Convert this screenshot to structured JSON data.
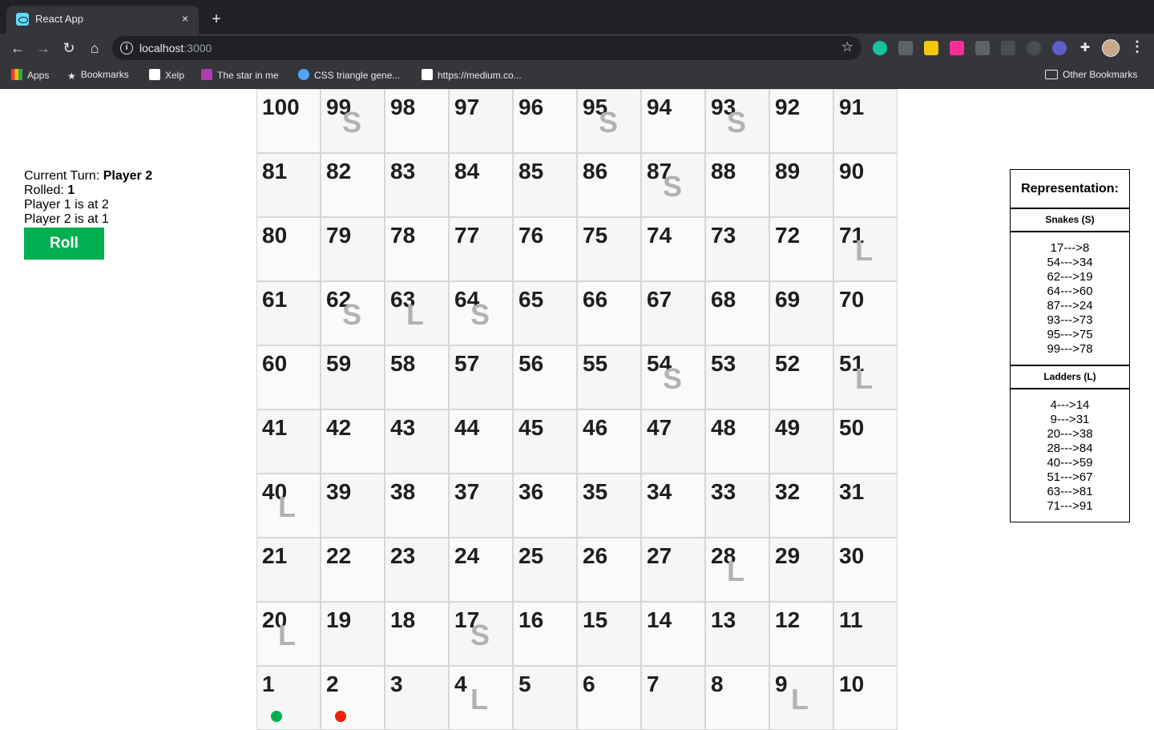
{
  "browser": {
    "tab_title": "React App",
    "tab_close": "×",
    "new_tab": "+",
    "url_host": "localhost",
    "url_port": ":3000",
    "bookmarks": [
      {
        "label": "Apps",
        "icon": "apps-grid-icon",
        "color": "#e94235"
      },
      {
        "label": "Bookmarks",
        "icon": "star-icon",
        "color": "#e8eaed"
      },
      {
        "label": "Xelp",
        "icon": "xelp-logo-icon",
        "color": "#ffffff"
      },
      {
        "label": "The star in me",
        "icon": "star-in-me-icon",
        "color": "#b23ab0"
      },
      {
        "label": "CSS triangle gene...",
        "icon": "css-triangle-icon",
        "color": "#4fa3ff"
      },
      {
        "label": "https://medium.co...",
        "icon": "medium-logo-icon",
        "color": "#ffffff"
      }
    ],
    "other_bookmarks": "Other Bookmarks"
  },
  "game": {
    "turn_label": "Current Turn: ",
    "turn_value": "Player 2",
    "rolled_label": "Rolled: ",
    "rolled_value": "1",
    "player1_status": "Player 1 is at 2",
    "player2_status": "Player 2 is at 1",
    "roll_button": "Roll"
  },
  "board": {
    "rows": [
      [
        100,
        99,
        98,
        97,
        96,
        95,
        94,
        93,
        92,
        91
      ],
      [
        81,
        82,
        83,
        84,
        85,
        86,
        87,
        88,
        89,
        90
      ],
      [
        80,
        79,
        78,
        77,
        76,
        75,
        74,
        73,
        72,
        71
      ],
      [
        61,
        62,
        63,
        64,
        65,
        66,
        67,
        68,
        69,
        70
      ],
      [
        60,
        59,
        58,
        57,
        56,
        55,
        54,
        53,
        52,
        51
      ],
      [
        41,
        42,
        43,
        44,
        45,
        46,
        47,
        48,
        49,
        50
      ],
      [
        40,
        39,
        38,
        37,
        36,
        35,
        34,
        33,
        32,
        31
      ],
      [
        21,
        22,
        23,
        24,
        25,
        26,
        27,
        28,
        29,
        30
      ],
      [
        20,
        19,
        18,
        17,
        16,
        15,
        14,
        13,
        12,
        11
      ],
      [
        1,
        2,
        3,
        4,
        5,
        6,
        7,
        8,
        9,
        10
      ]
    ],
    "snake_cells": [
      17,
      54,
      62,
      64,
      87,
      93,
      95,
      99
    ],
    "ladder_cells": [
      4,
      9,
      20,
      28,
      40,
      51,
      63,
      71
    ],
    "snake_marker": "S",
    "ladder_marker": "L",
    "tokens": [
      {
        "player": "Player 1",
        "cell": 1,
        "color": "#00b050"
      },
      {
        "player": "Player 2",
        "cell": 2,
        "color": "#f01e0a"
      }
    ]
  },
  "legend": {
    "title": "Representation:",
    "snakes_title": "Snakes (S)",
    "snakes": [
      "17--->8",
      "54--->34",
      "62--->19",
      "64--->60",
      "87--->24",
      "93--->73",
      "95--->75",
      "99--->78"
    ],
    "ladders_title": "Ladders (L)",
    "ladders": [
      "4--->14",
      "9--->31",
      "20--->38",
      "28--->84",
      "40--->59",
      "51--->67",
      "63--->81",
      "71--->91"
    ]
  },
  "colors": {
    "roll_button_bg": "#00b050",
    "marker_gray": "#b2b2b2"
  }
}
